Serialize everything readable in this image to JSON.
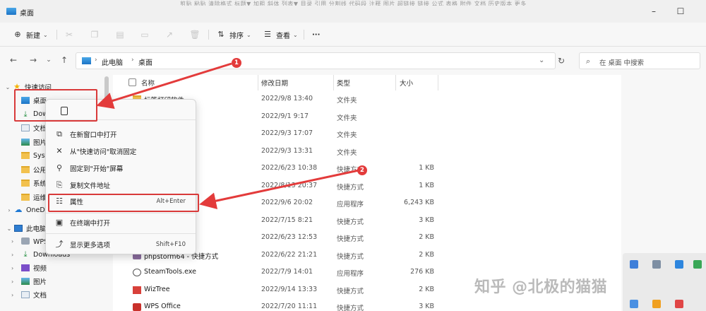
{
  "window": {
    "title": "桌面",
    "ribbon_ghost": "剪贴   粘贴   清除格式   标题▼   加粗   斜体   列表▼   目录   引用   分割线   代码段   注释   图片   超链接   链接   公式   表格   附件   文档   历史版本   更多"
  },
  "commandbar": {
    "new_label": "新建",
    "sort_label": "排序",
    "view_label": "查看",
    "more_label": "···"
  },
  "nav": {
    "crumbs": [
      "此电脑",
      "桌面"
    ],
    "search_placeholder": "在 桌面 中搜索"
  },
  "sidebar": {
    "quick_access": "快速访问",
    "items": [
      {
        "label": "桌面",
        "icon": "desktop-icon"
      },
      {
        "label": "Downloads",
        "icon": "download-icon"
      },
      {
        "label": "文档",
        "icon": "document-icon"
      },
      {
        "label": "图片",
        "icon": "picture-icon"
      },
      {
        "label": "System",
        "icon": "folder-icon"
      },
      {
        "label": "公用",
        "icon": "folder-icon"
      },
      {
        "label": "系统",
        "icon": "folder-icon"
      },
      {
        "label": "运维",
        "icon": "folder-icon"
      }
    ],
    "onedrive": "OneDrive",
    "this_pc": "此电脑",
    "pc_items": [
      {
        "label": "WPS网盘",
        "icon": "wps-icon"
      },
      {
        "label": "Downloads",
        "icon": "download-icon"
      },
      {
        "label": "视频",
        "icon": "video-icon"
      },
      {
        "label": "图片",
        "icon": "picture-icon"
      },
      {
        "label": "文档",
        "icon": "document-icon"
      }
    ]
  },
  "list": {
    "headers": {
      "name": "名称",
      "date": "修改日期",
      "type": "类型",
      "size": "大小"
    },
    "rows": [
      {
        "name": "标签打印软件",
        "date": "2022/9/8 13:40",
        "type": "文件夹",
        "size": "",
        "icon": "folder"
      },
      {
        "name": "4.1 重构版",
        "date": "2022/9/1 9:17",
        "type": "文件夹",
        "size": "",
        "icon": "folder"
      },
      {
        "name": "",
        "date": "2022/9/3 17:07",
        "type": "文件夹",
        "size": "",
        "icon": "folder"
      },
      {
        "name": "版",
        "date": "2022/9/3 13:31",
        "type": "文件夹",
        "size": "",
        "icon": "folder"
      },
      {
        "name": "N",
        "date": "2022/6/23 10:38",
        "type": "快捷方式",
        "size": "1 KB",
        "icon": "exe"
      },
      {
        "name": "式",
        "date": "2022/8/13 20:37",
        "type": "快捷方式",
        "size": "1 KB",
        "icon": "exe"
      },
      {
        "name": "xe",
        "date": "2022/9/6 20:02",
        "type": "应用程序",
        "size": "6,243 KB",
        "icon": "exe"
      },
      {
        "name": "",
        "date": "2022/7/15 8:21",
        "type": "快捷方式",
        "size": "3 KB",
        "icon": "exe"
      },
      {
        "name": "捷方式",
        "date": "2022/6/23 12:53",
        "type": "快捷方式",
        "size": "2 KB",
        "icon": "exe"
      },
      {
        "name": "phpstorm64 - 快捷方式",
        "date": "2022/6/22 21:21",
        "type": "快捷方式",
        "size": "2 KB",
        "icon": "exe"
      },
      {
        "name": "SteamTools.exe",
        "date": "2022/7/9 14:01",
        "type": "应用程序",
        "size": "276 KB",
        "icon": "steam"
      },
      {
        "name": "WizTree",
        "date": "2022/9/14 13:33",
        "type": "快捷方式",
        "size": "2 KB",
        "icon": "tree"
      },
      {
        "name": "WPS Office",
        "date": "2022/7/20 11:11",
        "type": "快捷方式",
        "size": "3 KB",
        "icon": "wps"
      }
    ]
  },
  "context_menu": {
    "items": [
      {
        "label": "在新窗口中打开",
        "shortcut": "",
        "icon": "open-window-icon"
      },
      {
        "label": "从\"快速访问\"取消固定",
        "shortcut": "",
        "icon": "unpin-icon"
      },
      {
        "label": "固定到\"开始\"屏幕",
        "shortcut": "",
        "icon": "pin-icon"
      },
      {
        "label": "复制文件地址",
        "shortcut": "",
        "icon": "copy-path-icon"
      },
      {
        "label": "属性",
        "shortcut": "Alt+Enter",
        "icon": "properties-icon"
      },
      {
        "label": "在终端中打开",
        "shortcut": "",
        "icon": "terminal-icon"
      },
      {
        "label": "显示更多选项",
        "shortcut": "Shift+F10",
        "icon": "more-options-icon"
      }
    ]
  },
  "annotations": {
    "marker_1": "1",
    "marker_2": "2",
    "color": "#e33b3b"
  },
  "watermark": "知乎 @北极的猫猫"
}
